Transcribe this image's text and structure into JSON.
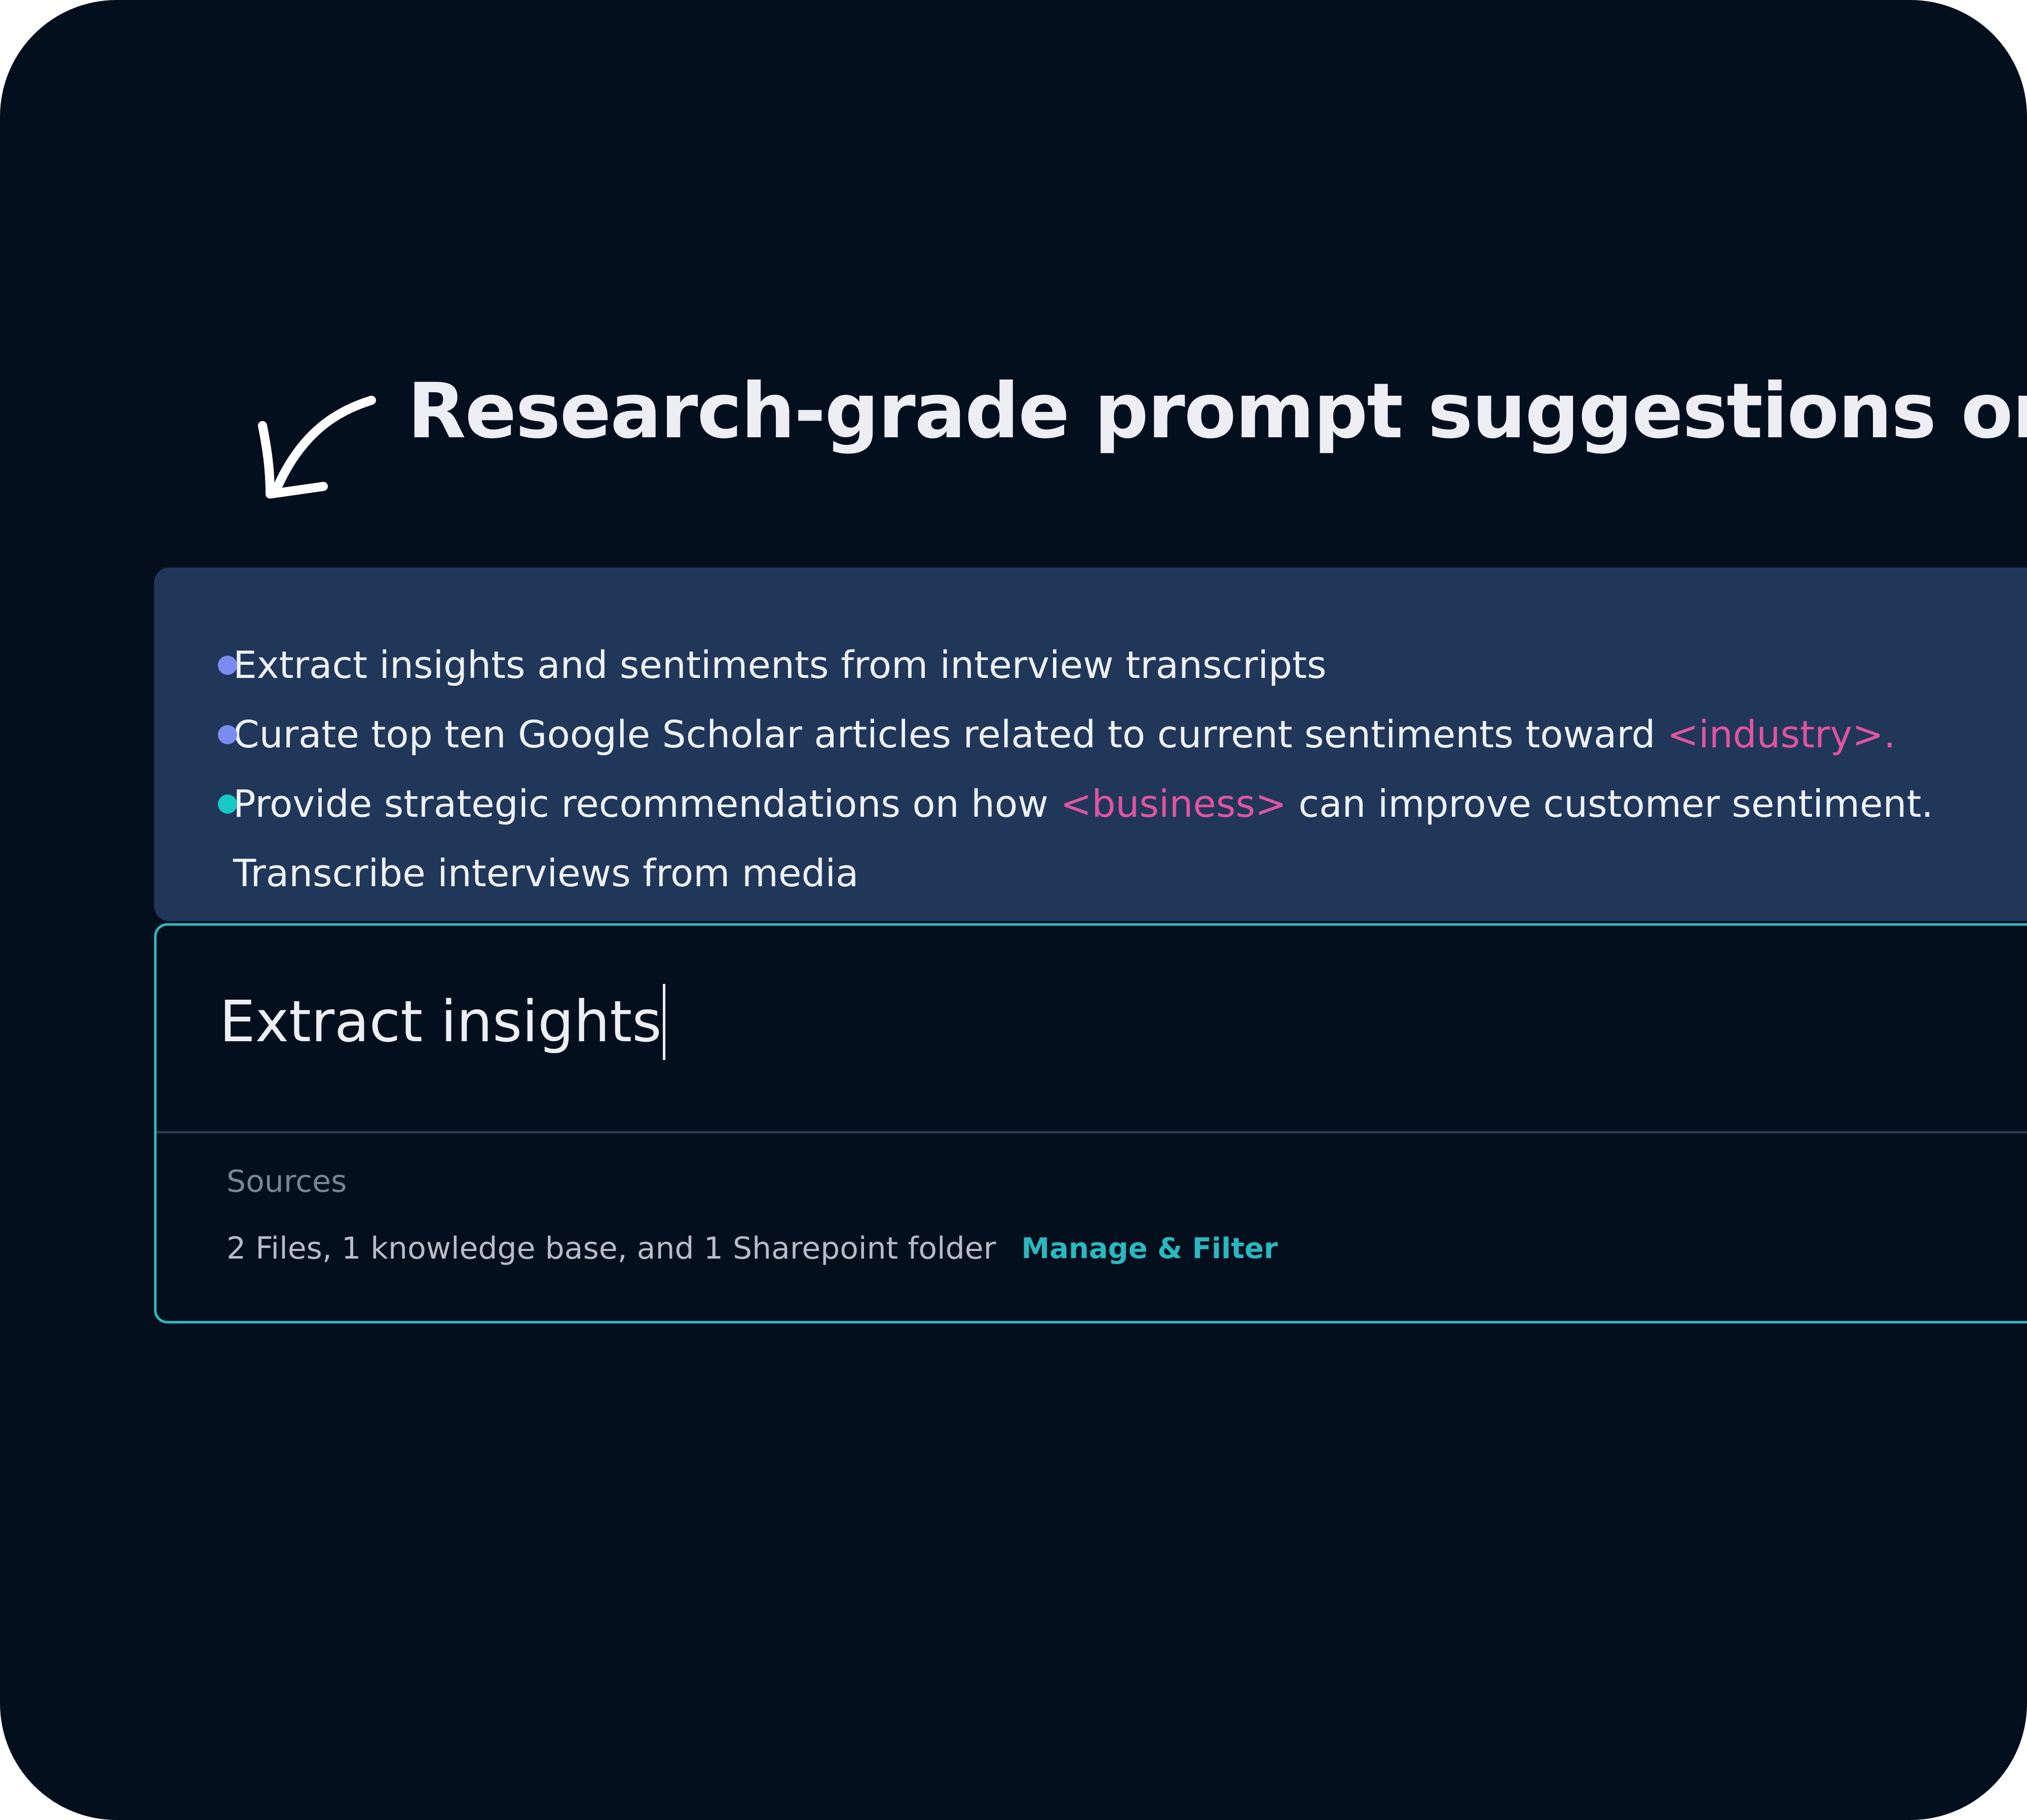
{
  "headline": "Research-grade prompt suggestions on type",
  "suggestions": [
    {
      "dot_color": "#7b8cf0",
      "text": "Extract insights and sentiments from interview transcripts",
      "placeholder": "",
      "text_after": ""
    },
    {
      "dot_color": "#7b8cf0",
      "text": "Curate top ten Google Scholar articles related to current sentiments toward ",
      "placeholder": "<industry>.",
      "text_after": ""
    },
    {
      "dot_color": "#17c9c4",
      "text": "Provide strategic recommendations on how ",
      "placeholder": "<business>",
      "text_after": " can improve customer sentiment."
    },
    {
      "dot_color": "",
      "text": "Transcribe interviews from media",
      "placeholder": "",
      "text_after": ""
    }
  ],
  "input": {
    "value": "Extract insights",
    "sources_label": "Sources",
    "sources_summary": "2 Files, 1 knowledge base, and 1 Sharepoint folder",
    "manage_link": "Manage & Filter"
  },
  "colors": {
    "background": "#040f1e",
    "panel": "#20375a",
    "accent": "#2bb7bd",
    "placeholder": "#e0549f"
  },
  "icons": {
    "arrow": "curved-arrow-down-left-icon"
  }
}
